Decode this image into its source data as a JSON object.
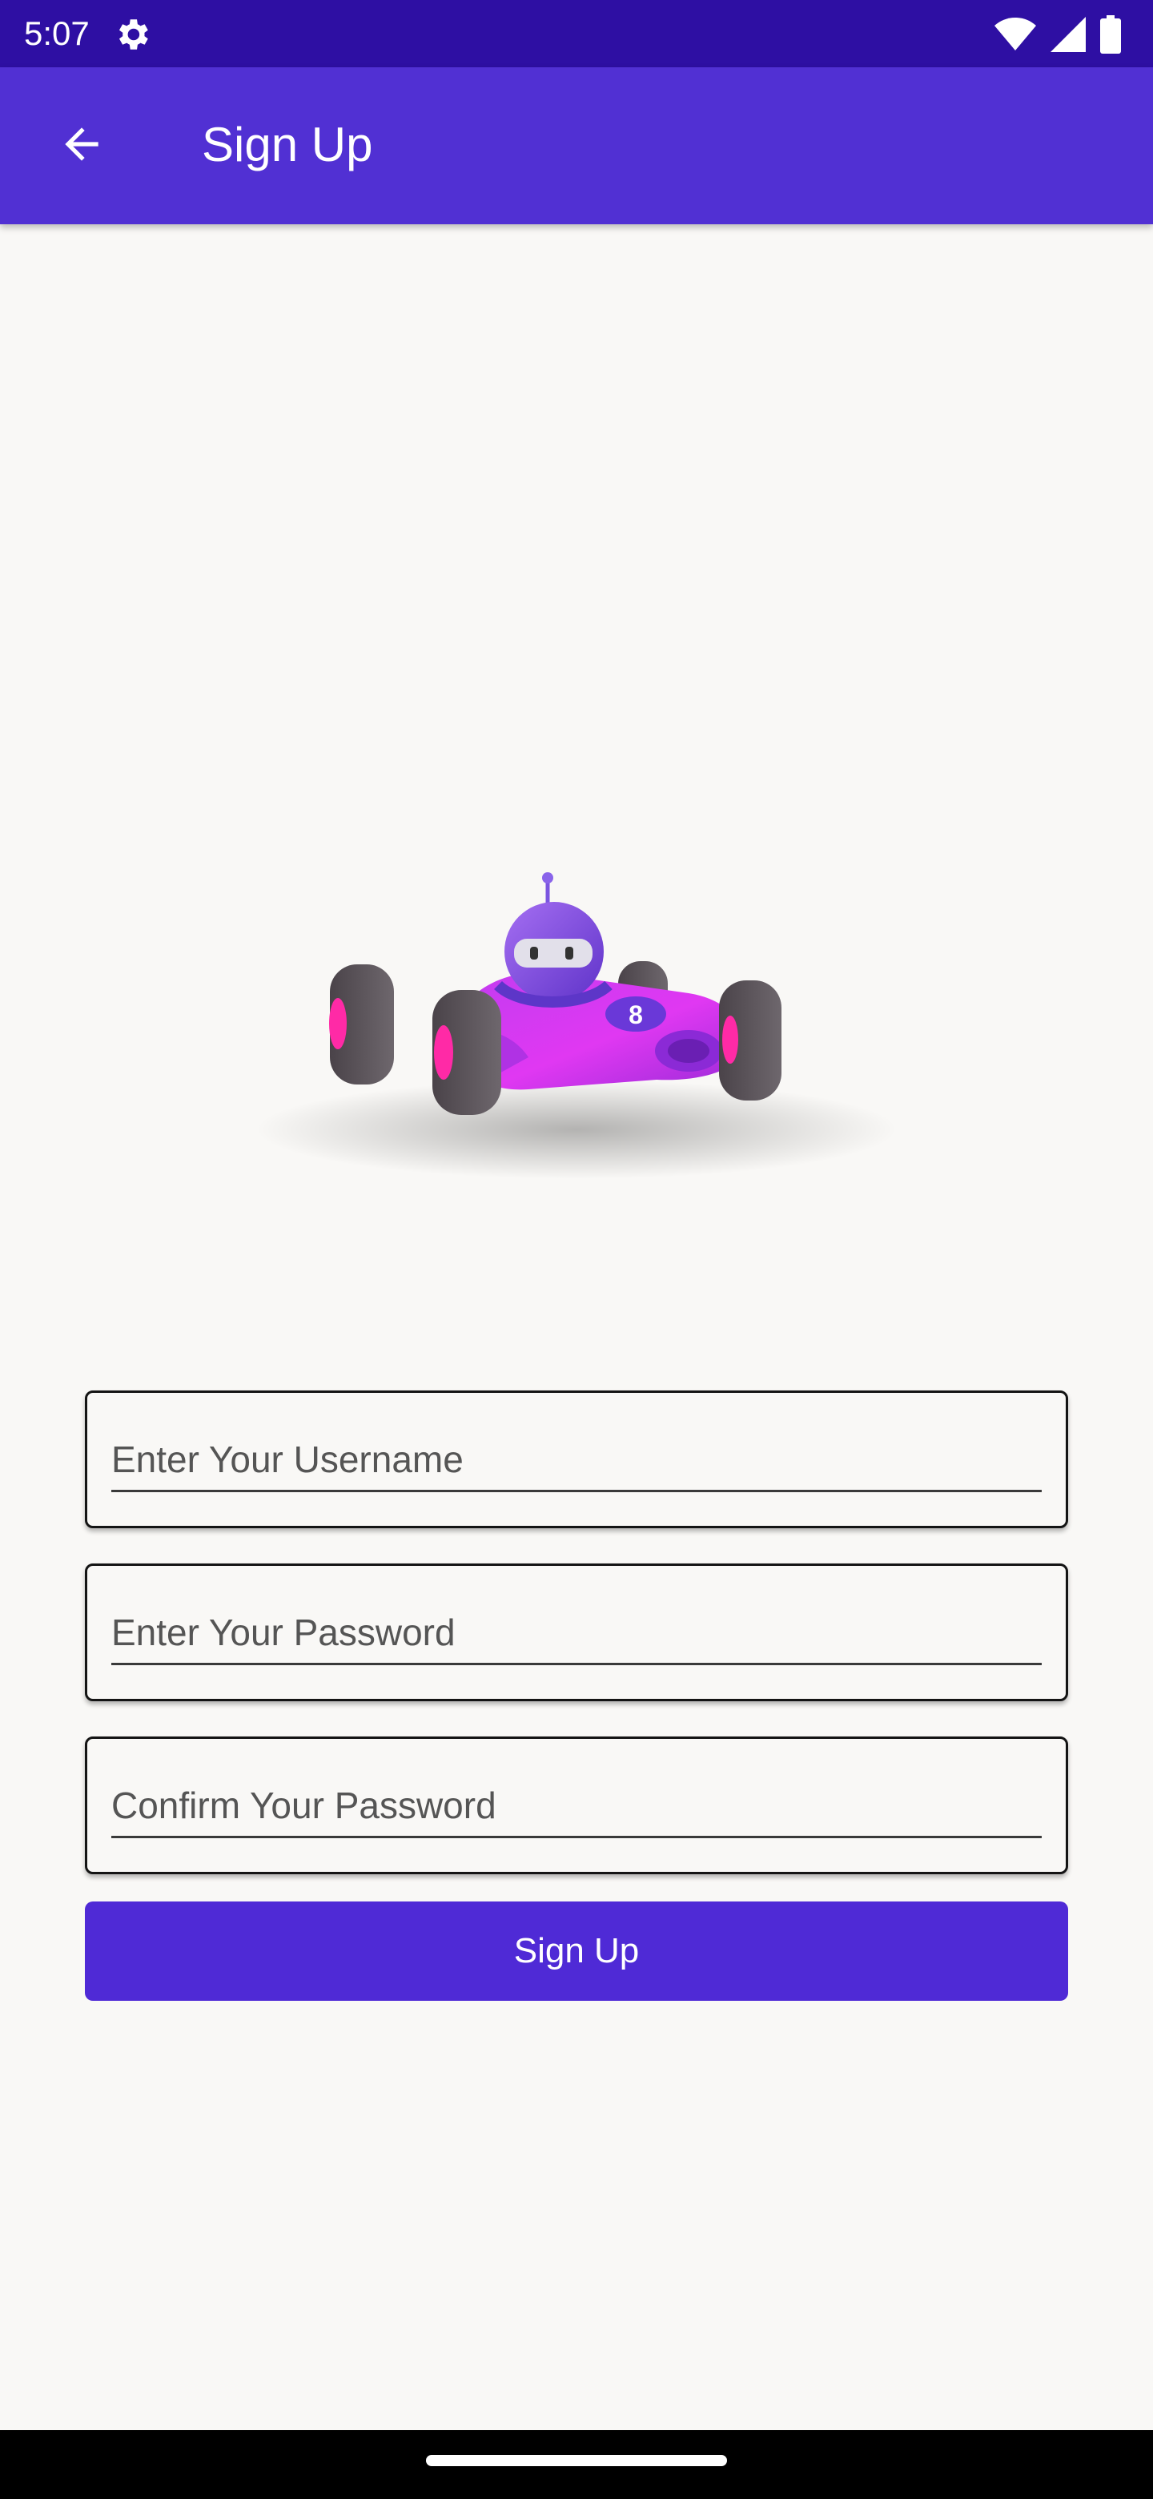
{
  "status_bar": {
    "time": "5:07",
    "icons": [
      "settings-gear-icon",
      "wifi-icon",
      "cell-signal-icon",
      "battery-icon"
    ],
    "background": "#2e0fa3"
  },
  "app_bar": {
    "title": "Sign Up",
    "back_icon": "arrow-back-icon",
    "background": "#5130d3"
  },
  "hero_image": {
    "subject": "purple race car with robot driver",
    "car_number": "8"
  },
  "form": {
    "username": {
      "value": "",
      "placeholder": "Enter Your Username"
    },
    "password": {
      "value": "",
      "placeholder": "Enter Your Password"
    },
    "confirm_password": {
      "value": "",
      "placeholder": "Confirm Your Password"
    },
    "submit_label": "Sign Up",
    "accent_color": "#4f2ad6"
  }
}
